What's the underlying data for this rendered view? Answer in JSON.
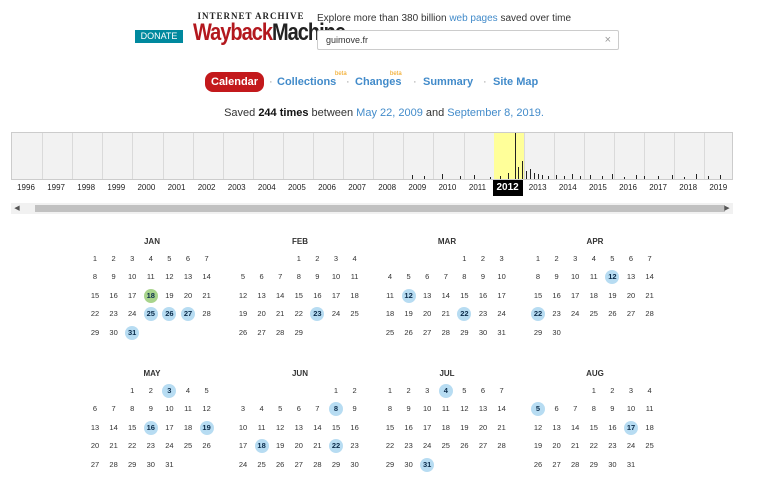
{
  "header": {
    "donate_label": "DONATE",
    "logo_top": "INTERNET ARCHIVE",
    "logo_wayback": "Wayback",
    "logo_machine": "Machine",
    "tagline_prefix": "Explore more than 380 billion ",
    "tagline_link": "web pages",
    "tagline_suffix": " saved over time",
    "search_value": "guimove.fr",
    "clear_icon": "×"
  },
  "tabs": {
    "calendar": "Calendar",
    "collections": "Collections",
    "changes": "Changes",
    "summary": "Summary",
    "sitemap": "Site Map",
    "beta": "beta",
    "separator": "·"
  },
  "saved": {
    "prefix": "Saved ",
    "count": "244 times",
    "mid": " between ",
    "start": "May 22, 2009",
    "and": " and ",
    "end": "September 8, 2019."
  },
  "timeline": {
    "years": [
      "1996",
      "1997",
      "1998",
      "1999",
      "2000",
      "2001",
      "2002",
      "2003",
      "2004",
      "2005",
      "2006",
      "2007",
      "2008",
      "2009",
      "2010",
      "2011",
      "2012",
      "2013",
      "2014",
      "2015",
      "2016",
      "2017",
      "2018",
      "2019"
    ],
    "selected_year": "2012",
    "scroll_left": "◀",
    "scroll_right": "▶"
  },
  "calendar": {
    "months": [
      {
        "name": "JAN",
        "start": 0,
        "days": 31,
        "captures": [
          18,
          25,
          26,
          27,
          31
        ],
        "highlight": 18
      },
      {
        "name": "FEB",
        "start": 3,
        "days": 29,
        "captures": [
          23
        ]
      },
      {
        "name": "MAR",
        "start": 4,
        "days": 31,
        "captures": [
          12,
          22
        ]
      },
      {
        "name": "APR",
        "start": 0,
        "days": 30,
        "captures": [
          12,
          22
        ]
      },
      {
        "name": "MAY",
        "start": 2,
        "days": 31,
        "captures": [
          3,
          16,
          19
        ]
      },
      {
        "name": "JUN",
        "start": 5,
        "days": 30,
        "captures": [
          8,
          18,
          22
        ]
      },
      {
        "name": "JUL",
        "start": 0,
        "days": 31,
        "captures": [
          4,
          31
        ]
      },
      {
        "name": "AUG",
        "start": 3,
        "days": 31,
        "captures": [
          5,
          17
        ]
      }
    ]
  }
}
